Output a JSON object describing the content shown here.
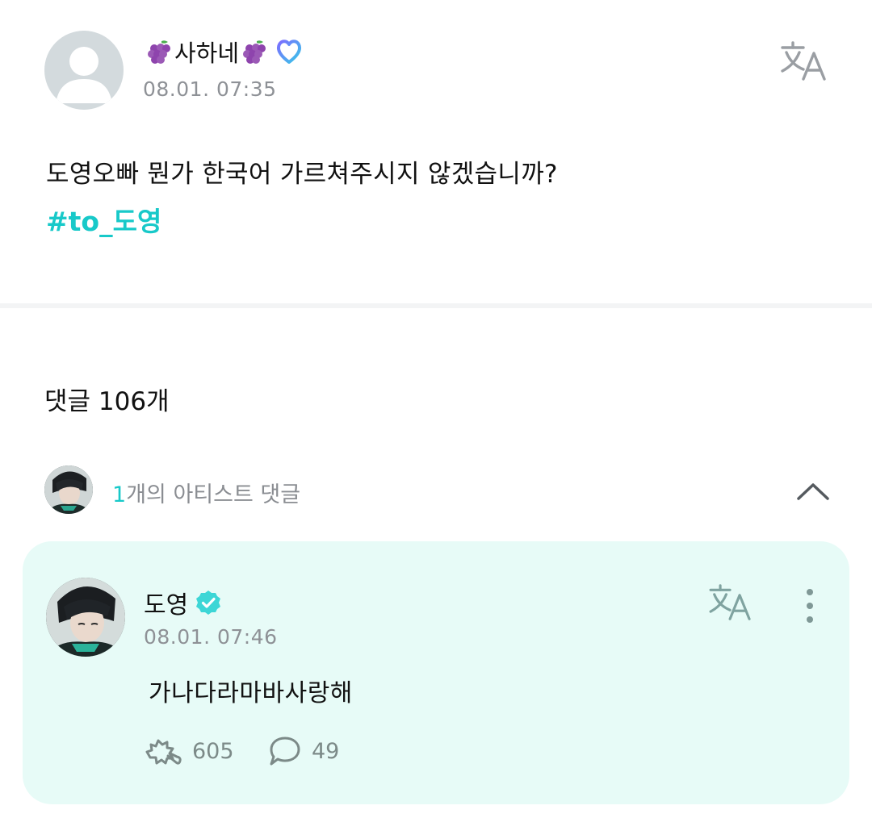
{
  "post": {
    "author_name": "사하네",
    "timestamp": "08.01. 07:35",
    "body": "도영오빠 뭔가 한국어 가르쳐주시지 않겠습니까?",
    "hashtag": "#to_도영"
  },
  "comments": {
    "count_label": "댓글 106개",
    "artist_comment_count": "1",
    "artist_comment_label": "개의 아티스트 댓글"
  },
  "artist_comment": {
    "author": "도영",
    "timestamp": "08.01. 07:46",
    "text": "가나다라마바사랑해",
    "likes": "605",
    "replies": "49"
  },
  "colors": {
    "accent": "#18c9c9",
    "card_background": "#e7fbf7",
    "muted_text": "#8e9196",
    "verified_badge": "#3dd6d6"
  },
  "icons": [
    "grape-emoji",
    "membership-heart-icon",
    "translate-icon",
    "chevron-up-icon",
    "verified-badge-icon",
    "more-vertical-icon",
    "like-icon",
    "reply-icon"
  ]
}
